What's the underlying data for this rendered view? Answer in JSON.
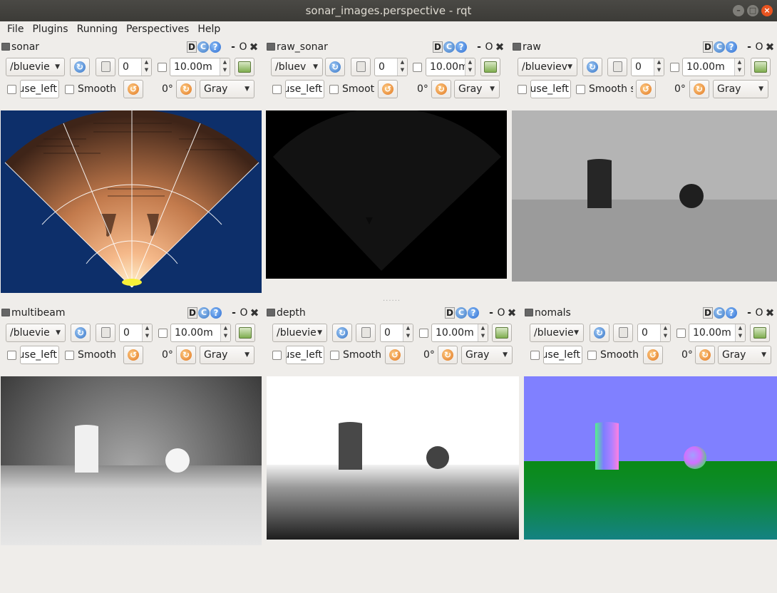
{
  "window": {
    "title": "sonar_images.perspective - rqt"
  },
  "menu": [
    {
      "label": "File"
    },
    {
      "label": "Plugins"
    },
    {
      "label": "Running"
    },
    {
      "label": "Perspectives"
    },
    {
      "label": "Help"
    }
  ],
  "header_icons": {
    "detach": "D",
    "reload": "C",
    "help": "?",
    "minimize": "-",
    "float": "O",
    "close": "✖"
  },
  "panels": {
    "sonar": {
      "title": "sonar",
      "topic": "/bluevie",
      "min": "0",
      "max": "10.00m",
      "field": "use_left",
      "smooth": "Smooth",
      "rotation": "0°",
      "colormap": "Gray"
    },
    "raw_sonar": {
      "title": "raw_sonar",
      "topic": "/bluev",
      "min": "0",
      "max": "10.00m",
      "field": "use_left",
      "smooth": "Smoot",
      "rotation": "0°",
      "colormap": "Gray"
    },
    "raw": {
      "title": "raw",
      "topic": "/blueviev",
      "min": "0",
      "max": "10.00m",
      "field": "use_left",
      "smooth": "Smooth s",
      "rotation": "0°",
      "colormap": "Gray"
    },
    "multibeam": {
      "title": "multibeam",
      "topic": "/bluevie",
      "min": "0",
      "max": "10.00m",
      "field": "use_left",
      "smooth": "Smooth",
      "rotation": "0°",
      "colormap": "Gray"
    },
    "depth": {
      "title": "depth",
      "topic": "/bluevie",
      "min": "0",
      "max": "10.00m",
      "field": "use_left",
      "smooth": "Smooth",
      "rotation": "0°",
      "colormap": "Gray"
    },
    "normals": {
      "title": "nomals",
      "topic": "/bluevie",
      "min": "0",
      "max": "10.00m",
      "field": "use_left",
      "smooth": "Smooth",
      "rotation": "0°",
      "colormap": "Gray"
    }
  },
  "colors": {
    "sonar_bg": "#0d2f6a",
    "titlebar": "#3c3b37",
    "window_bg": "#efedea"
  }
}
